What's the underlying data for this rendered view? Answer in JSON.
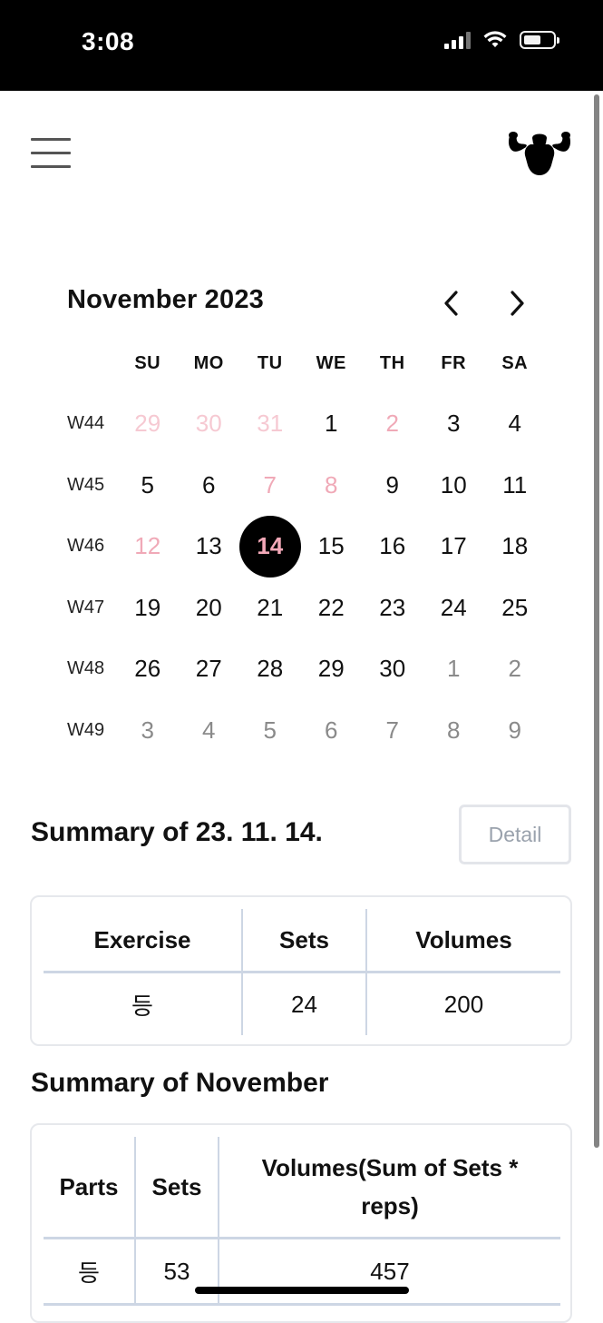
{
  "status_bar": {
    "time": "3:08"
  },
  "calendar": {
    "title": "November 2023",
    "weekdays": [
      "SU",
      "MO",
      "TU",
      "WE",
      "TH",
      "FR",
      "SA"
    ],
    "weeks": [
      {
        "label": "W44",
        "days": [
          "29",
          "30",
          "31",
          "1",
          "2",
          "3",
          "4"
        ]
      },
      {
        "label": "W45",
        "days": [
          "5",
          "6",
          "7",
          "8",
          "9",
          "10",
          "11"
        ]
      },
      {
        "label": "W46",
        "days": [
          "12",
          "13",
          "14",
          "15",
          "16",
          "17",
          "18"
        ]
      },
      {
        "label": "W47",
        "days": [
          "19",
          "20",
          "21",
          "22",
          "23",
          "24",
          "25"
        ]
      },
      {
        "label": "W48",
        "days": [
          "26",
          "27",
          "28",
          "29",
          "30",
          "1",
          "2"
        ]
      },
      {
        "label": "W49",
        "days": [
          "3",
          "4",
          "5",
          "6",
          "7",
          "8",
          "9"
        ]
      }
    ],
    "selected_day": "14",
    "colors": {
      "weekend_faint": "#f6c9d2",
      "holiday_pink": "#f0a9b7",
      "selected_bg": "#000000",
      "selected_text": "#f2a8b8",
      "outside_month": "#8a8a8a"
    }
  },
  "day_summary": {
    "title": "Summary of 23. 11. 14.",
    "detail_label": "Detail",
    "columns": [
      "Exercise",
      "Sets",
      "Volumes"
    ],
    "rows": [
      [
        "등",
        "24",
        "200"
      ]
    ]
  },
  "month_summary": {
    "title": "Summary of November",
    "columns": [
      "Parts",
      "Sets",
      "Volumes(Sum of Sets * reps)"
    ],
    "rows": [
      [
        "등",
        "53",
        "457"
      ]
    ]
  },
  "icons": {
    "menu": "hamburger-menu-icon",
    "logo": "muscle-man-logo",
    "prev": "chevron-left-icon",
    "next": "chevron-right-icon"
  }
}
